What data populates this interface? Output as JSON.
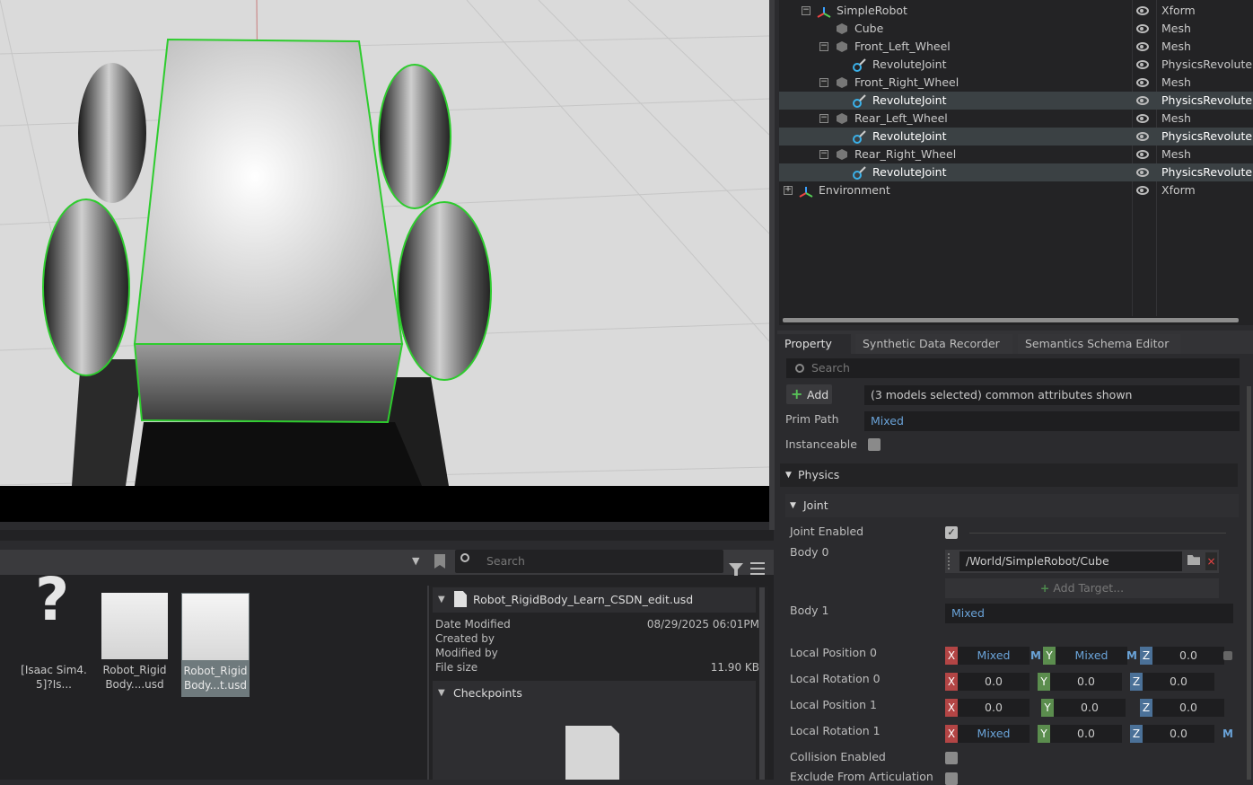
{
  "stage": {
    "rows": [
      {
        "name": "SimpleRobot",
        "type": "Xform"
      },
      {
        "name": "Cube",
        "type": "Mesh"
      },
      {
        "name": "Front_Left_Wheel",
        "type": "Mesh"
      },
      {
        "name": "RevoluteJoint",
        "type": "PhysicsRevolute"
      },
      {
        "name": "Front_Right_Wheel",
        "type": "Mesh"
      },
      {
        "name": "RevoluteJoint",
        "type": "PhysicsRevolute"
      },
      {
        "name": "Rear_Left_Wheel",
        "type": "Mesh"
      },
      {
        "name": "RevoluteJoint",
        "type": "PhysicsRevolute"
      },
      {
        "name": "Rear_Right_Wheel",
        "type": "Mesh"
      },
      {
        "name": "RevoluteJoint",
        "type": "PhysicsRevolute"
      },
      {
        "name": "Environment",
        "type": "Xform"
      }
    ]
  },
  "content_browser": {
    "search_placeholder": "Search",
    "items": [
      {
        "label": "."
      },
      {
        "label": "[Isaac Sim4.\n5]?Is..."
      },
      {
        "label": "Robot_Rigid\nBody....usd"
      },
      {
        "label": "Robot_Rigid\nBody...t.usd"
      }
    ],
    "detail": {
      "filename": "Robot_RigidBody_Learn_CSDN_edit.usd",
      "date_modified_label": "Date Modified",
      "date_modified": "08/29/2025 06:01PM",
      "created_by_label": "Created by",
      "modified_by_label": "Modified by",
      "file_size_label": "File size",
      "file_size": "11.90 KB",
      "checkpoints_label": "Checkpoints"
    }
  },
  "property": {
    "tabs": [
      "Property",
      "Synthetic Data Recorder",
      "Semantics Schema Editor"
    ],
    "search_placeholder": "Search",
    "add_label": "Add",
    "selection_info": "(3 models selected) common attributes shown",
    "prim_path_label": "Prim Path",
    "prim_path_value": "Mixed",
    "instanceable_label": "Instanceable",
    "physics_label": "Physics",
    "joint_label": "Joint",
    "joint_enabled_label": "Joint Enabled",
    "body0_label": "Body 0",
    "body0_value": "/World/SimpleRobot/Cube",
    "add_target_label": "Add Target...",
    "body1_label": "Body 1",
    "body1_value": "Mixed",
    "local_pos0_label": "Local Position 0",
    "local_rot0_label": "Local Rotation 0",
    "local_pos1_label": "Local Position 1",
    "local_rot1_label": "Local Rotation 1",
    "collision_label": "Collision Enabled",
    "exclude_label": "Exclude From Articulation",
    "local_pos0": {
      "x": "Mixed",
      "y": "Mixed",
      "z": "0.0"
    },
    "local_rot0": {
      "x": "0.0",
      "y": "0.0",
      "z": "0.0"
    },
    "local_pos1": {
      "x": "0.0",
      "y": "0.0",
      "z": "0.0"
    },
    "local_rot1": {
      "x": "Mixed",
      "y": "0.0",
      "z": "0.0"
    },
    "axis": {
      "x": "X",
      "y": "Y",
      "z": "Z"
    },
    "m_marker": "M"
  },
  "colors": {
    "selection_outline": "#2ecc2e",
    "mixed": "#6aa3d8"
  }
}
